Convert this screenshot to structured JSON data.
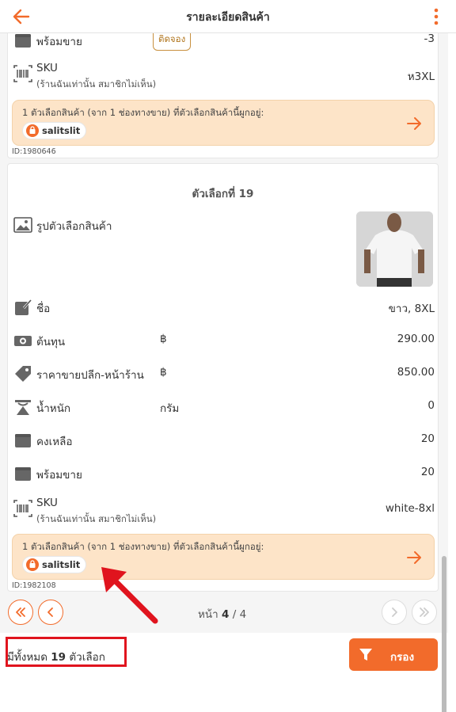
{
  "header": {
    "title": "รายละเอียดสินค้า"
  },
  "variant_prev": {
    "ready_label": "พร้อมขาย",
    "reserved_badge": "ติดจอง",
    "ready_value": "-3",
    "sku_label": "SKU",
    "sku_sub": "(ร้านฉันเท่านั้น สมาชิกไม่เห็น)",
    "sku_value": "ห3XL",
    "channel_text": "1 ตัวเลือกสินค้า (จาก 1 ช่องทางขาย) ที่ตัวเลือกสินค้านี้ผูกอยู่:",
    "channel_name": "salitslit",
    "id": "ID:1980646"
  },
  "variant": {
    "title": "ตัวเลือกที่ 19",
    "image_label": "รูปตัวเลือกสินค้า",
    "name_label": "ชื่อ",
    "name_value": "ขาว, 8XL",
    "cost_label": "ต้นทุน",
    "cost_unit": "฿",
    "cost_value": "290.00",
    "price_label": "ราคาขายปลีก-หน้าร้าน",
    "price_unit": "฿",
    "price_value": "850.00",
    "weight_label": "น้ำหนัก",
    "weight_unit": "กรัม",
    "weight_value": "0",
    "remaining_label": "คงเหลือ",
    "remaining_value": "20",
    "ready_label": "พร้อมขาย",
    "ready_value": "20",
    "sku_label": "SKU",
    "sku_sub": "(ร้านฉันเท่านั้น สมาชิกไม่เห็น)",
    "sku_value": "white-8xl",
    "channel_text": "1 ตัวเลือกสินค้า (จาก 1 ช่องทางขาย) ที่ตัวเลือกสินค้านี้ผูกอยู่:",
    "channel_name": "salitslit",
    "id": "ID:1982108"
  },
  "pagination": {
    "prefix": "หน้า",
    "current": "4",
    "separator": "/",
    "total": "4"
  },
  "footer": {
    "total_prefix": "มีทั้งหมด",
    "total_count": "19",
    "total_suffix": "ตัวเลือก",
    "filter_label": "กรอง"
  },
  "colors": {
    "accent": "#f26b2b",
    "channel_bg": "#fde4c8",
    "annotation": "#e0141e"
  }
}
